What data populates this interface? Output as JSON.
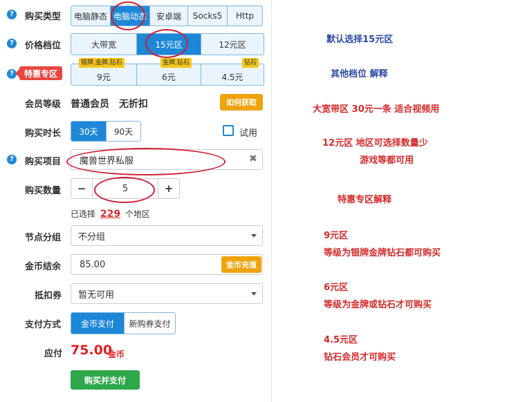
{
  "form": {
    "type": {
      "label": "购买类型",
      "options": [
        "电脑静态",
        "电脑动态",
        "安卓端",
        "Socks5",
        "Http"
      ],
      "selected": 1
    },
    "price": {
      "label": "价格档位",
      "options": [
        "大带宽",
        "15元区",
        "12元区"
      ],
      "selected": 1
    },
    "special": {
      "label": "特惠专区",
      "options": [
        "9元",
        "6元",
        "4.5元"
      ],
      "tags": [
        "银牌,金牌,钻石",
        "金牌,钻石",
        "钻石"
      ]
    },
    "member": {
      "label": "会员等级",
      "value": "普通会员",
      "discount": "无折扣",
      "get_button": "如何获取"
    },
    "duration": {
      "label": "购买时长",
      "options": [
        "30天",
        "90天"
      ],
      "selected": 0,
      "trial_label": "试用"
    },
    "project": {
      "label": "购买项目",
      "value": "魔兽世界私服"
    },
    "quantity": {
      "label": "购买数量",
      "value": "5",
      "minus": "−",
      "plus": "+"
    },
    "selected_info": {
      "prefix": "已选择",
      "count": "229",
      "suffix": "个地区"
    },
    "node_group": {
      "label": "节点分组",
      "value": "不分组"
    },
    "coin": {
      "label": "金币结余",
      "value": "85.00",
      "recharge": "金币充值"
    },
    "coupon": {
      "label": "抵扣券",
      "value": "暂无可用"
    },
    "payment": {
      "label": "支付方式",
      "options": [
        "金币支付",
        "新购券支付"
      ],
      "selected": 0
    },
    "total": {
      "label": "应付",
      "amount": "75.00",
      "unit": "金币"
    },
    "submit": "购买并支付"
  },
  "notes": {
    "n1": "默认选择15元区",
    "n2": "其他档位 解释",
    "n3": "大宽带区 30元一条  适合视频用",
    "n4a": "12元区 地区可选择数量少",
    "n4b": "游戏等都可用",
    "n5": "特惠专区解释",
    "n6a": "9元区",
    "n6b": "等级为银牌金牌钻石都可购买",
    "n7a": "6元区",
    "n7b": "等级为金牌或钻石才可购买",
    "n8a": "4.5元区",
    "n8b": "钻石会员才可购买"
  },
  "colors": {
    "primary": "#1e87d8",
    "annotation_red": "#d02030",
    "price_red": "#e02020",
    "submit_green": "#2ea84a",
    "gold": "#f0a30a"
  }
}
